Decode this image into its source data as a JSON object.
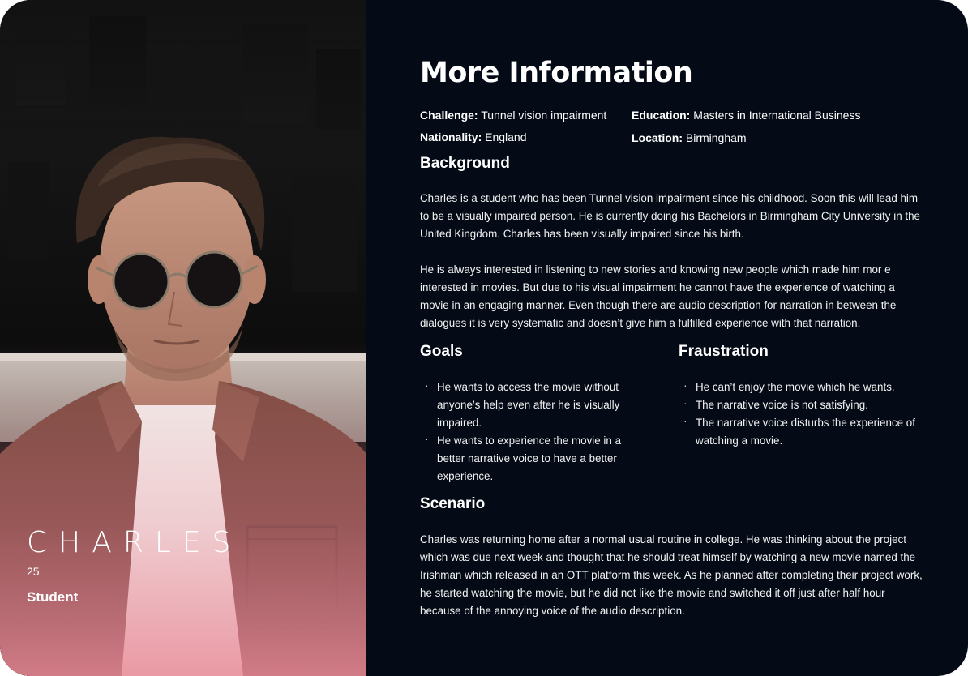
{
  "persona": {
    "name": "CHARLES",
    "age": "25",
    "role": "Student"
  },
  "info": {
    "title": "More Information",
    "facts": {
      "challenge_label": "Challenge:",
      "challenge_value": "Tunnel vision impairment",
      "nationality_label": "Nationality:",
      "nationality_value": "England",
      "education_label": "Education:",
      "education_value": "Masters in International Business",
      "location_label": "Location:",
      "location_value": "Birmingham"
    },
    "background": {
      "heading": "Background",
      "paragraphs": [
        "Charles is a student who has been Tunnel vision impairment since his childhood. Soon this will lead him to be a visually impaired person. He is currently doing his Bachelors in Birmingham City University in the United Kingdom. Charles has been visually impaired since his birth.",
        "He is always interested in listening to new stories and knowing new people which made him mor e interested in movies. But due to his visual impairment he cannot have the experience of watching a movie in an engaging manner. Even though there are audio description for narration in between the dialogues it is very systematic and doesn’t give him a fulfilled experience with that narration."
      ]
    },
    "goals": {
      "heading": "Goals",
      "items": [
        "He wants to access the movie without anyone’s help even after he is visually impaired.",
        "He wants to experience the movie in a better narrative voice to have a better experience."
      ]
    },
    "frustration": {
      "heading": "Fraustration",
      "items": [
        "He can’t enjoy the movie which he wants.",
        "The narrative voice is not satisfying.",
        "The narrative voice disturbs the experience of watching a movie."
      ]
    },
    "scenario": {
      "heading": "Scenario",
      "text": "Charles was returning home after a normal usual routine in college. He was thinking about the project which was due next week and thought that he should treat himself by watching a new movie named the Irishman which released in an OTT platform this week. As he planned after completing their project work, he started watching the movie, but he did not like the movie and switched it off just after half hour because of the annoying voice of the audio description."
    }
  },
  "colors": {
    "panel_bg": "#040b16",
    "text": "#ffffff",
    "photo_gradient_bottom": "#e98a97"
  }
}
